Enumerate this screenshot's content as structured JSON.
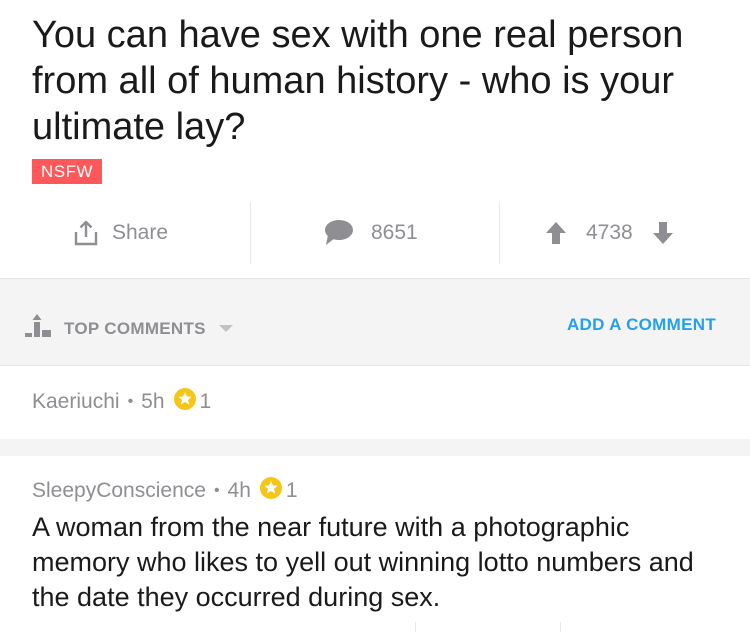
{
  "post": {
    "title": "You can have sex with one real person from all of human history - who is your ultimate lay?",
    "badge": "NSFW"
  },
  "actions": {
    "share_label": "Share",
    "comment_count": "8651",
    "score": "4738"
  },
  "sort_bar": {
    "label": "TOP COMMENTS",
    "add_comment_label": "ADD A COMMENT"
  },
  "comments": [
    {
      "author": "Kaeriuchi",
      "separator": "•",
      "age": "5h",
      "awards": "1",
      "body": ""
    },
    {
      "author": "SleepyConscience",
      "separator": "•",
      "age": "4h",
      "awards": "1",
      "body": "A woman from the near future with a photographic memory who likes to yell out winning lotto numbers and the date they occurred during sex."
    }
  ],
  "colors": {
    "nsfw": "#ff585b",
    "link": "#24a0ed",
    "muted": "#8e8e93",
    "award": "#f5c518"
  }
}
